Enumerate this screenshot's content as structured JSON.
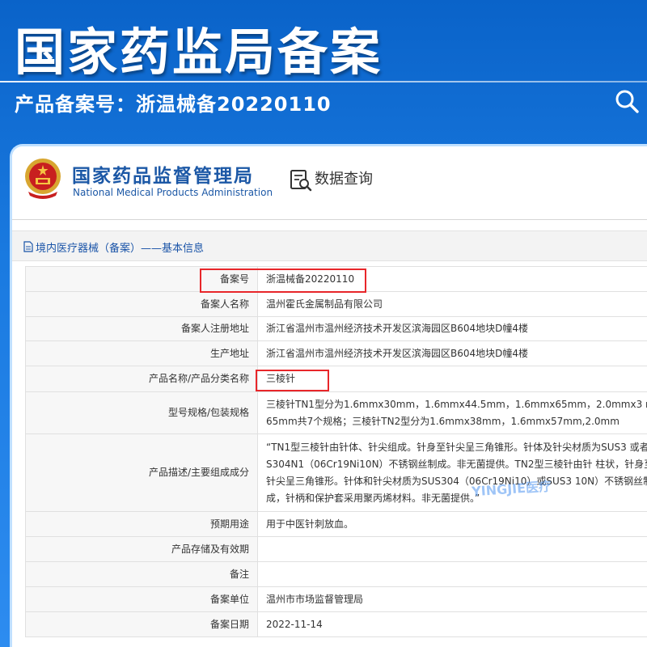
{
  "banner": {
    "title": "国家药监局备案",
    "subtitle": "产品备案号：浙温械备20220110",
    "search_icon": "search-icon"
  },
  "site": {
    "org_name": "国家药品监督管理局",
    "org_name_en": "National Medical Products Administration",
    "data_query_label": "数据查询",
    "emblem_icon": "national-emblem-icon",
    "data_query_icon": "data-query-icon"
  },
  "section": {
    "title": "境内医疗器械（备案）——基本信息",
    "icon": "document-icon"
  },
  "table": {
    "rows": [
      {
        "label": "备案号",
        "value": "浙温械备20220110"
      },
      {
        "label": "备案人名称",
        "value": "温州霍氏金属制品有限公司"
      },
      {
        "label": "备案人注册地址",
        "value": "浙江省温州市温州经济技术开发区滨海园区B604地块D幢4楼"
      },
      {
        "label": "生产地址",
        "value": "浙江省温州市温州经济技术开发区滨海园区B604地块D幢4楼"
      },
      {
        "label": "产品名称/产品分类名称",
        "value": "三棱针"
      },
      {
        "label": "型号规格/包装规格",
        "value": "三棱针TN1型分为1.6mmx30mm，1.6mmx44.5mm，1.6mmx65mm，2.0mmx3 mx65mm共7个规格；三棱针TN2型分为1.6mmx38mm，1.6mmx57mm,2.0mm"
      },
      {
        "label": "产品描述/主要组成成分",
        "value": "“TN1型三棱针由针体、针尖组成。针身至针尖呈三角锥形。针体及针尖材质为SUS3 或者SUS304N1（06Cr19Ni10N）不锈钢丝制成。非无菌提供。TN2型三棱针由针 柱状，针身至针尖呈三角锥形。针体和针尖材质为SUS304（06Cr19Ni10）或SUS3 10N）不锈钢丝制成，针柄和保护套采用聚丙烯材料。非无菌提供。”"
      },
      {
        "label": "预期用途",
        "value": "用于中医针刺放血。"
      },
      {
        "label": "产品存储及有效期",
        "value": ""
      },
      {
        "label": "备注",
        "value": ""
      },
      {
        "label": "备案单位",
        "value": "温州市市场监督管理局"
      },
      {
        "label": "备案日期",
        "value": "2022-11-14"
      }
    ]
  },
  "watermark": "YINGJIE医疗",
  "colors": {
    "highlight": "#e8262a",
    "brand_blue": "#1c58a6",
    "banner_blue": "#0a63c9"
  }
}
